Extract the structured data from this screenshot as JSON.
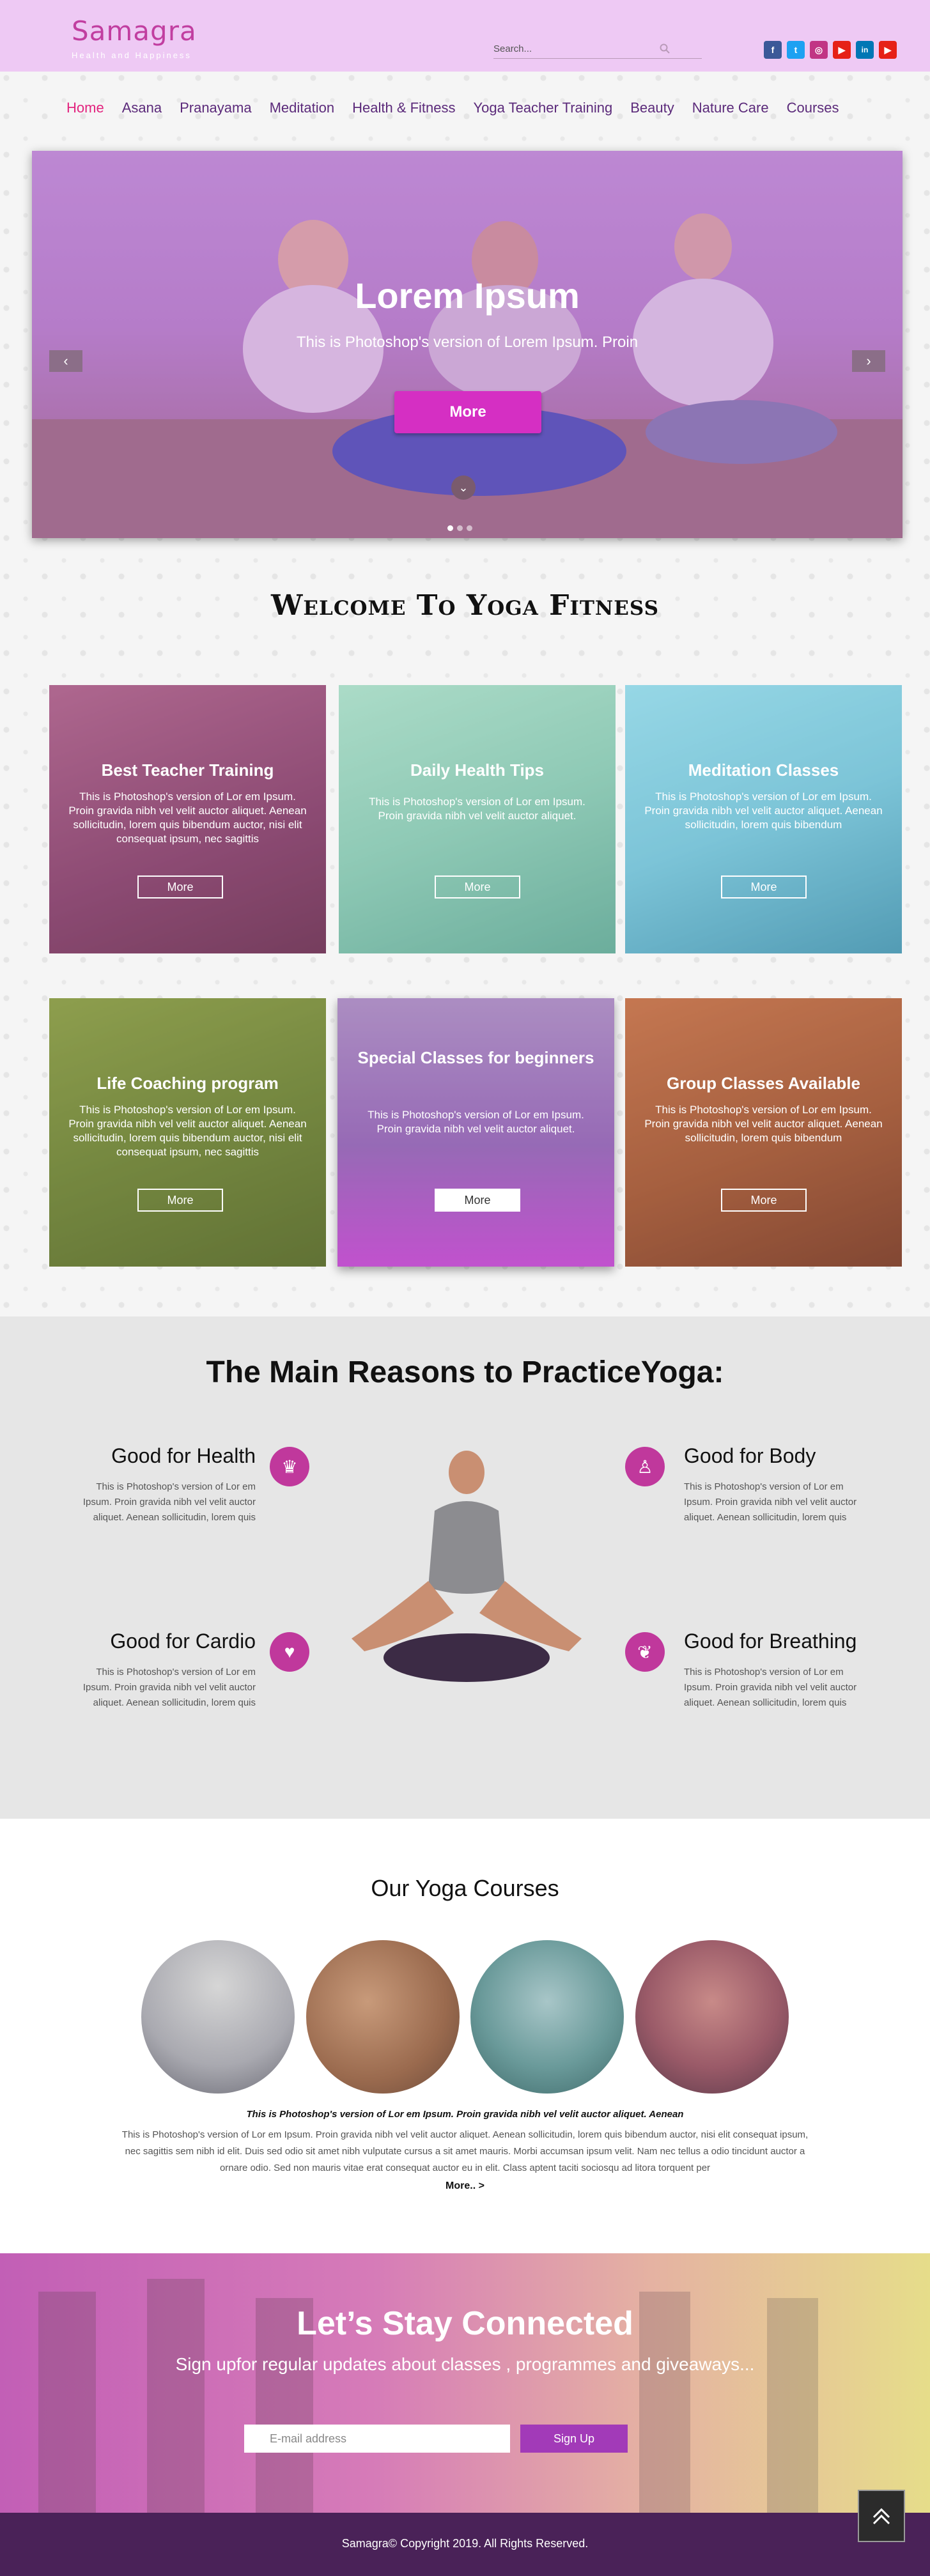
{
  "header": {
    "logo_title": "Samagra",
    "logo_tagline": "Health and Happiness",
    "search_placeholder": "Search...",
    "socials": [
      {
        "name": "facebook",
        "glyph": "f",
        "color": "#3b5998"
      },
      {
        "name": "twitter",
        "glyph": "t",
        "color": "#1da1f2"
      },
      {
        "name": "instagram",
        "glyph": "◎",
        "color": "#c13584"
      },
      {
        "name": "youtube",
        "glyph": "▶",
        "color": "#e62117"
      },
      {
        "name": "linkedin",
        "glyph": "in",
        "color": "#0077b5"
      },
      {
        "name": "youtube-alt",
        "glyph": "▶",
        "color": "#e62117"
      }
    ]
  },
  "nav": [
    {
      "label": "Home",
      "active": true
    },
    {
      "label": "Asana"
    },
    {
      "label": "Pranayama"
    },
    {
      "label": "Meditation"
    },
    {
      "label": "Health & Fitness"
    },
    {
      "label": "Yoga Teacher Training"
    },
    {
      "label": "Beauty"
    },
    {
      "label": "Nature Care"
    },
    {
      "label": "Courses"
    }
  ],
  "hero": {
    "title": "Lorem Ipsum",
    "subtitle": "This is Photoshop's version  of Lorem Ipsum. Proin",
    "button": "More",
    "prev": "‹",
    "next": "›",
    "down": "⌄"
  },
  "welcome": {
    "title": "Welcome To Yoga Fitness",
    "cards": [
      {
        "title": "Best Teacher Training",
        "text": "This is Photoshop's version  of Lor  em Ipsum. Proin gravida nibh vel velit auctor aliquet. Aenean sollicitudin, lorem quis bibendum auctor, nisi elit consequat ipsum, nec sagittis",
        "button": "More"
      },
      {
        "title": "Daily Health Tips",
        "text": "This is Photoshop's version  of Lor  em Ipsum. Proin gravida nibh vel velit auctor aliquet.",
        "button": "More"
      },
      {
        "title": "Meditation Classes",
        "text": "This is Photoshop's version  of Lor  em Ipsum. Proin gravida nibh vel velit auctor aliquet. Aenean sollicitudin, lorem quis bibendum",
        "button": "More"
      },
      {
        "title": "Life Coaching program",
        "text": "This is Photoshop's version  of Lor  em Ipsum. Proin gravida nibh vel velit auctor aliquet. Aenean sollicitudin, lorem quis bibendum auctor, nisi elit consequat ipsum, nec sagittis",
        "button": "More"
      },
      {
        "title": "Special Classes for beginners",
        "text": "This is Photoshop's version  of Lor  em Ipsum. Proin gravida nibh vel velit auctor aliquet.",
        "button": "More"
      },
      {
        "title": "Group Classes Available",
        "text": "This is Photoshop's version  of Lor  em Ipsum. Proin gravida nibh vel velit auctor aliquet. Aenean sollicitudin, lorem quis bibendum",
        "button": "More"
      }
    ]
  },
  "reasons": {
    "title": "The Main Reasons to PracticeYoga:",
    "items": [
      {
        "title": "Good for Health",
        "text": "This is Photoshop's version  of Lor  em Ipsum. Proin gravida nibh vel velit auctor aliquet. Aenean sollicitudin, lorem quis",
        "icon": "crown-icon"
      },
      {
        "title": "Good for Body",
        "text": "This is Photoshop's version  of Lor  em Ipsum. Proin gravida nibh vel velit auctor aliquet. Aenean sollicitudin, lorem quis",
        "icon": "body-icon"
      },
      {
        "title": "Good for Cardio",
        "text": "This is Photoshop's version  of Lor  em Ipsum. Proin gravida nibh vel velit auctor aliquet. Aenean sollicitudin, lorem quis",
        "icon": "heart-icon"
      },
      {
        "title": "Good for Breathing",
        "text": "This is Photoshop's version  of Lor  em Ipsum. Proin gravida nibh vel velit auctor aliquet. Aenean sollicitudin, lorem quis",
        "icon": "lungs-icon"
      }
    ]
  },
  "courses": {
    "title": "Our Yoga Courses",
    "lead": "This is Photoshop's version  of Lor  em Ipsum. Proin gravida nibh vel velit auctor aliquet. Aenean",
    "body": "This is Photoshop's version  of Lor  em Ipsum. Proin gravida nibh vel velit auctor aliquet. Aenean sollicitudin, lorem quis bibendum auctor, nisi elit consequat ipsum, nec sagittis sem nibh id elit. Duis sed odio sit amet nibh vulputate cursus a sit amet mauris. Morbi accumsan ipsum velit. Nam nec tellus a odio tincidunt auctor a ornare odio. Sed non  mauris vitae erat consequat auctor eu in elit. Class aptent taciti sociosqu ad litora torquent per",
    "more": "More.. >"
  },
  "connect": {
    "title": "Let’s Stay Connected",
    "subtitle": "Sign upfor regular updates about classes , programmes and giveaways...",
    "email_placeholder": "E-mail address",
    "button": "Sign Up"
  },
  "footer": {
    "text": "Samagra© Copyright 2019. All Rights Reserved."
  }
}
